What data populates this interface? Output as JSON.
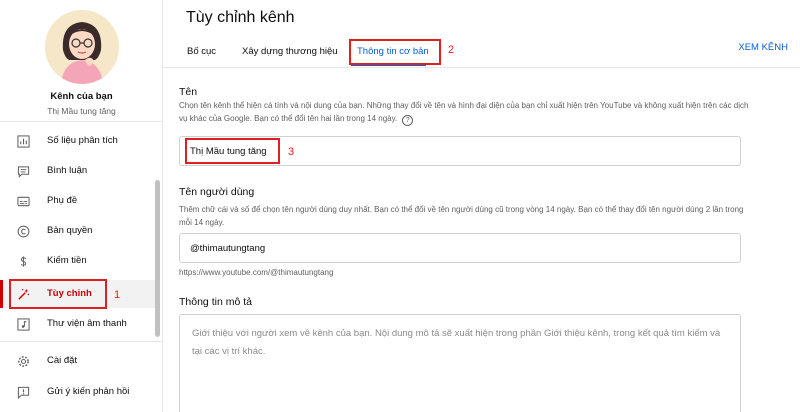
{
  "sidebar": {
    "channel_title": "Kênh của bạn",
    "channel_name": "Thị Mầu tung tăng",
    "items": [
      {
        "label": "Số liệu phân tích",
        "icon": "analytics-icon"
      },
      {
        "label": "Bình luận",
        "icon": "comments-icon"
      },
      {
        "label": "Phụ đề",
        "icon": "subtitles-icon"
      },
      {
        "label": "Bản quyền",
        "icon": "copyright-icon"
      },
      {
        "label": "Kiếm tiền",
        "icon": "monetization-icon"
      },
      {
        "label": "Tùy chỉnh",
        "icon": "magic-wand-icon",
        "active": true
      },
      {
        "label": "Thư viện âm thanh",
        "icon": "audio-library-icon"
      }
    ],
    "bottom_items": [
      {
        "label": "Cài đặt",
        "icon": "settings-gear-icon"
      },
      {
        "label": "Gửi ý kiến phản hồi",
        "icon": "feedback-icon"
      }
    ]
  },
  "header": {
    "title": "Tùy chỉnh kênh",
    "tabs": [
      {
        "label": "Bố cục"
      },
      {
        "label": "Xây dựng thương hiệu"
      },
      {
        "label": "Thông tin cơ bản",
        "active": true
      }
    ],
    "view_channel": "XEM KÊNH"
  },
  "main": {
    "name_section": {
      "title": "Tên",
      "description": "Chọn tên kênh thể hiện cá tính và nội dung của bạn. Những thay đổi về tên và hình đại diện của bạn chỉ xuất hiện trên YouTube và không xuất hiện trên các dịch vụ khác của Google. Bạn có thể đổi tên hai lần trong 14 ngày.",
      "value": "Thị Mầu tung tăng"
    },
    "handle_section": {
      "title": "Tên người dùng",
      "description": "Thêm chữ cái và số để chọn tên người dùng duy nhất. Bạn có thể đổi về tên người dùng cũ trong vòng 14 ngày. Bạn có thể thay đổi tên người dùng 2 lần trong mỗi 14 ngày.",
      "value": "@thimautungtang",
      "url": "https://www.youtube.com/@thimautungtang"
    },
    "description_section": {
      "title": "Thông tin mô tả",
      "placeholder": "Giới thiệu với người xem về kênh của bạn. Nội dung mô tả sẽ xuất hiện trong phần Giới thiệu kênh, trong kết quả tìm kiếm và tại các vị trí khác."
    }
  },
  "annotations": {
    "n1": "1",
    "n2": "2",
    "n3": "3"
  },
  "help_glyph": "?",
  "colors": {
    "accent_red": "#cc0000",
    "link_blue": "#065fd4",
    "annotation_red": "#e02020"
  }
}
